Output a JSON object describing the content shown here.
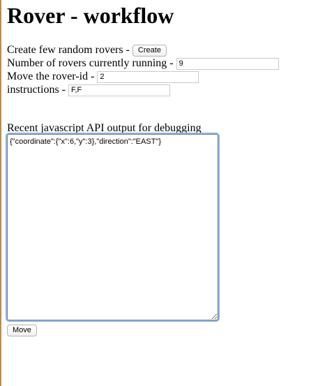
{
  "page": {
    "title": "Rover - workflow"
  },
  "create_row": {
    "label": "Create few random rovers -",
    "button_label": "Create"
  },
  "count_row": {
    "label": "Number of rovers currently running -",
    "value": "9"
  },
  "move_rover_row": {
    "label": "Move the rover-id -",
    "value": "2"
  },
  "instructions_row": {
    "label": "instructions -",
    "value": "F,F"
  },
  "debug": {
    "label": "Recent javascript API output for debugging",
    "output": "{\"coordinate\":{\"x\":6,\"y\":3},\"direction\":\"EAST\"}"
  },
  "move_button": {
    "label": "Move"
  },
  "colors": {
    "focus_ring": "#8ab4e8",
    "left_edge": "#c58a44"
  }
}
